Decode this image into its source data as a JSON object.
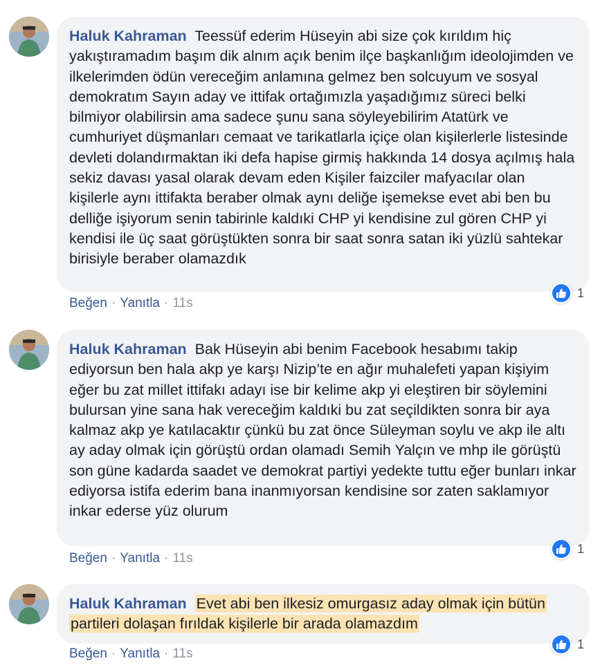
{
  "comments": [
    {
      "author": "Haluk Kahraman",
      "text": "Teessüf ederim Hüseyin abi size çok kırıldım hiç yakıştıramadım başım dik alnım açık benim ilçe başkanlığım ideolojimden ve ilkelerimden ödün vereceğim anlamına gelmez ben solcuyum ve sosyal demokratım Sayın aday ve ittifak ortağımızla yaşadığımız süreci belki bilmiyor olabilirsin ama sadece şunu sana söyleyebilirim Atatürk ve cumhuriyet düşmanları cemaat ve tarikatlarla içiçe olan kişilerlerle listesinde devleti dolandırmaktan iki defa hapise girmiş hakkında 14 dosya açılmış hala sekiz davası yasal olarak devam eden Kişiler faizciler mafyacılar olan kişilerle aynı ittifakta beraber olmak aynı deliğe işemekse evet abi ben bu delliğe işiyorum senin tabirinle kaldıki CHP yi kendisine zul gören CHP yi kendisi ile üç saat görüştükten sonra bir saat sonra satan iki yüzlü sahtekar birisiyle beraber olamazdık",
      "like_label": "Beğen",
      "reply_label": "Yanıtla",
      "separator": "·",
      "time": "11s",
      "reaction_count": "1"
    },
    {
      "author": "Haluk Kahraman",
      "text": "Bak Hüseyin abi benim Facebook hesabımı takip ediyorsun ben hala akp ye karşı Nizip’te en ağır muhalefeti yapan kişiyim eğer bu zat millet ittifakı adayı ise bir kelime akp yi eleştiren bir söylemini bulursan yine sana hak vereceğim kaldıki bu zat seçildikten sonra bir aya kalmaz akp ye katılacaktır çünkü bu zat önce Süleyman soylu ve akp ile altı ay aday olmak için görüştü ordan olamadı Semih Yalçın ve mhp ile görüştü son güne kadarda saadet ve demokrat partiyi yedekte tuttu eğer bunları inkar ediyorsa istifa ederim bana inanmıyorsan kendisine sor zaten saklamıyor inkar ederse yüz olurum",
      "like_label": "Beğen",
      "reply_label": "Yanıtla",
      "separator": "·",
      "time": "11s",
      "reaction_count": "1"
    },
    {
      "author": "Haluk Kahraman",
      "text": "Evet abi ben ilkesiz omurgasız aday olmak için bütün partileri dolaşan fırıldak kişilerle bir arada olamazdım",
      "like_label": "Beğen",
      "reply_label": "Yanıtla",
      "separator": "·",
      "time": "11s",
      "reaction_count": "1"
    }
  ],
  "colors": {
    "author": "#385898",
    "bubble": "#f2f3f5",
    "highlight": "#fbe3b4",
    "like_blue": "#2078f4"
  },
  "icons": {
    "reaction": "like-thumb-icon",
    "avatar": "profile-photo"
  }
}
